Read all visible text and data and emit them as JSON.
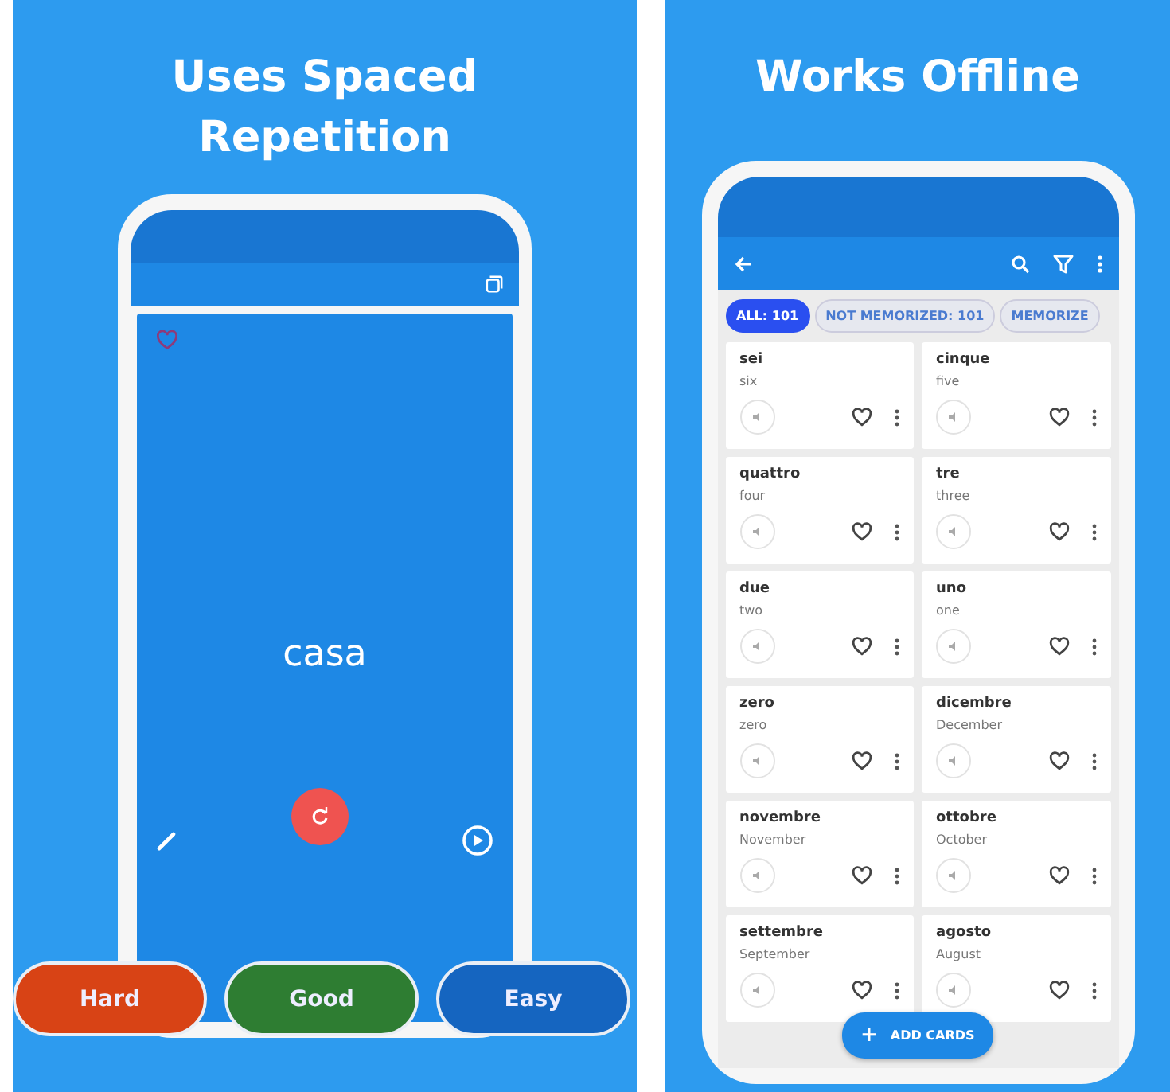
{
  "panels": [
    {
      "title": "Uses Spaced Repetition"
    },
    {
      "title": "Works Offline"
    }
  ],
  "study_screen": {
    "word": "casa",
    "favorite": false
  },
  "rating_buttons": [
    {
      "label": "Hard",
      "color": "#d84315"
    },
    {
      "label": "Good",
      "color": "#2e7d32"
    },
    {
      "label": "Easy",
      "color": "#1565c0"
    }
  ],
  "filter_chips": [
    {
      "label": "ALL: 101",
      "selected": true
    },
    {
      "label": "NOT MEMORIZED: 101",
      "selected": false
    },
    {
      "label": "MEMORIZE",
      "selected": false
    }
  ],
  "cards": [
    {
      "word": "sei",
      "translation": "six"
    },
    {
      "word": "cinque",
      "translation": "five"
    },
    {
      "word": "quattro",
      "translation": "four"
    },
    {
      "word": "tre",
      "translation": "three"
    },
    {
      "word": "due",
      "translation": "two"
    },
    {
      "word": "uno",
      "translation": "one"
    },
    {
      "word": "zero",
      "translation": "zero"
    },
    {
      "word": "dicembre",
      "translation": "December"
    },
    {
      "word": "novembre",
      "translation": "November"
    },
    {
      "word": "ottobre",
      "translation": "October"
    },
    {
      "word": "settembre",
      "translation": "September"
    },
    {
      "word": "agosto",
      "translation": "August"
    }
  ],
  "fab": {
    "icon": "+",
    "label": "ADD CARDS"
  }
}
